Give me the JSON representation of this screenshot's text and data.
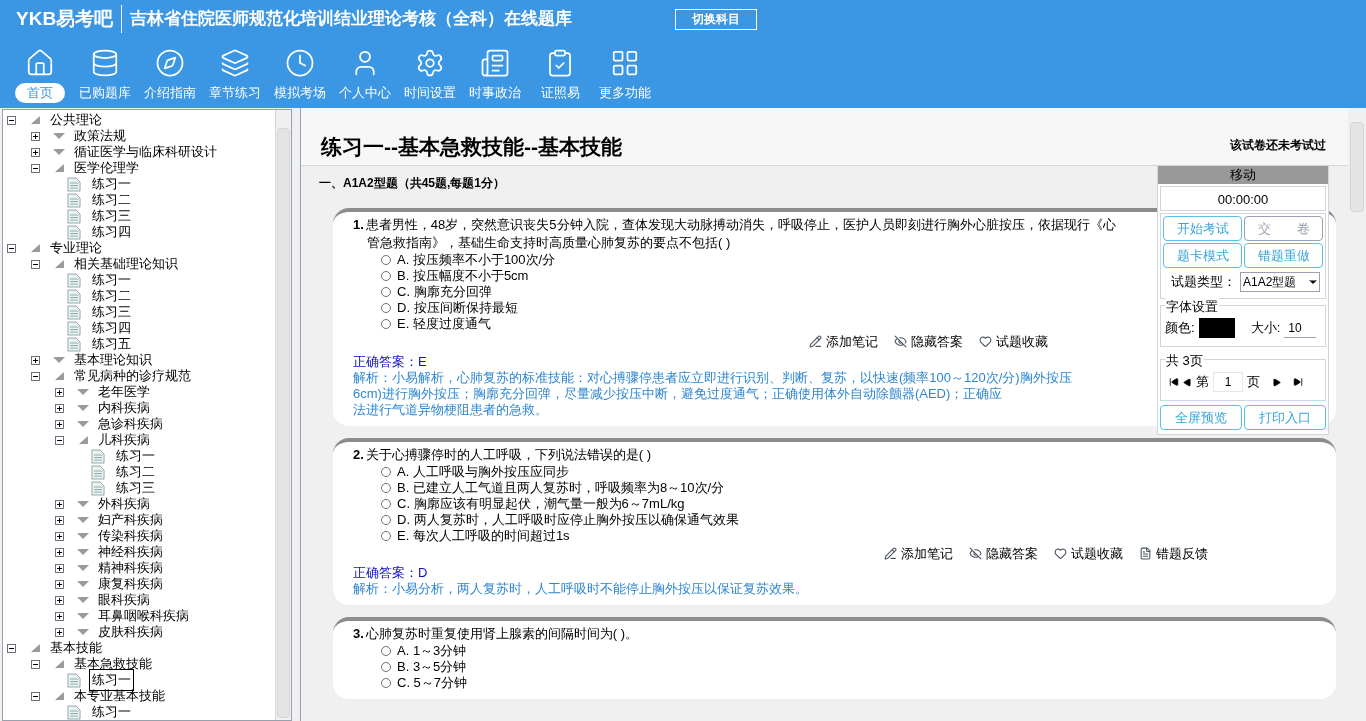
{
  "header": {
    "logo": "YKB易考吧",
    "title": "吉林省住院医师规范化培训结业理论考核（全科）在线题库",
    "switch_button": "切换科目"
  },
  "toolbar": [
    {
      "label": "首页",
      "selected": true
    },
    {
      "label": "已购题库",
      "selected": false
    },
    {
      "label": "介绍指南",
      "selected": false
    },
    {
      "label": "章节练习",
      "selected": false
    },
    {
      "label": "模拟考场",
      "selected": false
    },
    {
      "label": "个人中心",
      "selected": false
    },
    {
      "label": "时间设置",
      "selected": false
    },
    {
      "label": "时事政治",
      "selected": false
    },
    {
      "label": "证照易",
      "selected": false
    },
    {
      "label": "更多功能",
      "selected": false
    }
  ],
  "tree": [
    {
      "label": "公共理论",
      "kind": "folder",
      "expanded": true,
      "children": [
        {
          "label": "政策法规",
          "kind": "folder",
          "expanded": false
        },
        {
          "label": "循证医学与临床科研设计",
          "kind": "folder",
          "expanded": false
        },
        {
          "label": "医学伦理学",
          "kind": "folder",
          "expanded": true,
          "children": [
            {
              "label": "练习一",
              "kind": "leaf",
              "selected": false
            },
            {
              "label": "练习二",
              "kind": "leaf",
              "selected": false
            },
            {
              "label": "练习三",
              "kind": "leaf",
              "selected": false
            },
            {
              "label": "练习四",
              "kind": "leaf",
              "selected": false
            }
          ]
        }
      ]
    },
    {
      "label": "专业理论",
      "kind": "folder",
      "expanded": true,
      "children": [
        {
          "label": "相关基础理论知识",
          "kind": "folder",
          "expanded": true,
          "children": [
            {
              "label": "练习一",
              "kind": "leaf",
              "selected": false
            },
            {
              "label": "练习二",
              "kind": "leaf",
              "selected": false
            },
            {
              "label": "练习三",
              "kind": "leaf",
              "selected": false
            },
            {
              "label": "练习四",
              "kind": "leaf",
              "selected": false
            },
            {
              "label": "练习五",
              "kind": "leaf",
              "selected": false
            }
          ]
        },
        {
          "label": "基本理论知识",
          "kind": "folder",
          "expanded": false
        },
        {
          "label": "常见病种的诊疗规范",
          "kind": "folder",
          "expanded": true,
          "children": [
            {
              "label": "老年医学",
              "kind": "folder",
              "expanded": false
            },
            {
              "label": "内科疾病",
              "kind": "folder",
              "expanded": false
            },
            {
              "label": "急诊科疾病",
              "kind": "folder",
              "expanded": false
            },
            {
              "label": "儿科疾病",
              "kind": "folder",
              "expanded": true,
              "children": [
                {
                  "label": "练习一",
                  "kind": "leaf",
                  "selected": false
                },
                {
                  "label": "练习二",
                  "kind": "leaf",
                  "selected": false
                },
                {
                  "label": "练习三",
                  "kind": "leaf",
                  "selected": false
                }
              ]
            },
            {
              "label": "外科疾病",
              "kind": "folder",
              "expanded": false
            },
            {
              "label": "妇产科疾病",
              "kind": "folder",
              "expanded": false
            },
            {
              "label": "传染科疾病",
              "kind": "folder",
              "expanded": false
            },
            {
              "label": "神经科疾病",
              "kind": "folder",
              "expanded": false
            },
            {
              "label": "精神科疾病",
              "kind": "folder",
              "expanded": false
            },
            {
              "label": "康复科疾病",
              "kind": "folder",
              "expanded": false
            },
            {
              "label": "眼科疾病",
              "kind": "folder",
              "expanded": false
            },
            {
              "label": "耳鼻咽喉科疾病",
              "kind": "folder",
              "expanded": false
            },
            {
              "label": "皮肤科疾病",
              "kind": "folder",
              "expanded": false
            }
          ]
        }
      ]
    },
    {
      "label": "基本技能",
      "kind": "folder",
      "expanded": true,
      "children": [
        {
          "label": "基本急救技能",
          "kind": "folder",
          "expanded": true,
          "children": [
            {
              "label": "练习一",
              "kind": "leaf",
              "selected": true
            }
          ]
        },
        {
          "label": "本专业基本技能",
          "kind": "folder",
          "expanded": true,
          "children": [
            {
              "label": "练习一",
              "kind": "leaf",
              "selected": false
            }
          ]
        }
      ]
    }
  ],
  "paper": {
    "title": "练习一--基本急救技能--基本技能",
    "status": "该试卷还未考试过",
    "section": "一、A1A2型题（共45题,每题1分）"
  },
  "questions": [
    {
      "number": "1.",
      "lines": [
        "患者男性，48岁，突然意识丧失5分钟入院，查体发现大动脉搏动消失，呼吸停止，医护人员即刻进行胸外心脏按压，依据现行《心",
        "管急救指南》，基础生命支持时高质量心肺复苏的要点不包括( )"
      ],
      "options": [
        {
          "text": "A. 按压频率不小于100次/分",
          "selected": false
        },
        {
          "text": "B. 按压幅度不小于5cm",
          "selected": false
        },
        {
          "text": "C. 胸廓充分回弹",
          "selected": false
        },
        {
          "text": "D. 按压间断保持最短",
          "selected": false
        },
        {
          "text": "E. 轻度过度通气",
          "selected": false
        }
      ],
      "actions": [
        "添加笔记",
        "隐藏答案",
        "试题收藏"
      ],
      "answer": "正确答案：E",
      "analysis": [
        "解析：小易解析，心肺复苏的标准技能：对心搏骤停患者应立即进行识别、判断、复苏，以快速(频率100～120次/分)胸外按压",
        "6cm)进行胸外按压；胸廓充分回弹，尽量减少按压中断，避免过度通气；正确使用体外自动除颤器(AED)；正确应",
        "法进行气道异物梗阻患者的急救。"
      ]
    },
    {
      "number": "2.",
      "lines": [
        "关于心搏骤停时的人工呼吸，下列说法错误的是( )"
      ],
      "options": [
        {
          "text": "A. 人工呼吸与胸外按压应同步",
          "selected": false
        },
        {
          "text": "B. 已建立人工气道且两人复苏时，呼吸频率为8～10次/分",
          "selected": false
        },
        {
          "text": "C. 胸廓应该有明显起伏，潮气量一般为6～7mL/kg",
          "selected": false
        },
        {
          "text": "D. 两人复苏时，人工呼吸时应停止胸外按压以确保通气效果",
          "selected": false
        },
        {
          "text": "E. 每次人工呼吸的时间超过1s",
          "selected": false
        }
      ],
      "actions": [
        "添加笔记",
        "隐藏答案",
        "试题收藏",
        "错题反馈"
      ],
      "answer": "正确答案：D",
      "analysis": [
        "解析：小易分析，两人复苏时，人工呼吸时不能停止胸外按压以保证复苏效果。"
      ]
    },
    {
      "number": "3.",
      "lines": [
        "心肺复苏时重复使用肾上腺素的间隔时间为( )。"
      ],
      "options": [
        {
          "text": "A. 1～3分钟",
          "selected": false
        },
        {
          "text": "B. 3～5分钟",
          "selected": false
        },
        {
          "text": "C. 5～7分钟",
          "selected": false
        }
      ]
    }
  ],
  "panel": {
    "move": "移动",
    "timer": "00:00:00",
    "buttons": [
      {
        "label": "开始考试",
        "disabled": false
      },
      {
        "label": "交　　卷",
        "disabled": true
      },
      {
        "label": "题卡模式",
        "disabled": false
      },
      {
        "label": "错题重做",
        "disabled": false
      }
    ],
    "type_label": "试题类型：",
    "type_value": "A1A2型题",
    "font_legend": "字体设置",
    "color_label": "颜色:",
    "color": "#000000",
    "size_label": "大小:",
    "size_value": "10",
    "pages_legend": "共 3页",
    "page_prefix": "第",
    "page_value": "1",
    "page_suffix": "页",
    "bottom_buttons": [
      "全屏预览",
      "打印入口"
    ]
  }
}
